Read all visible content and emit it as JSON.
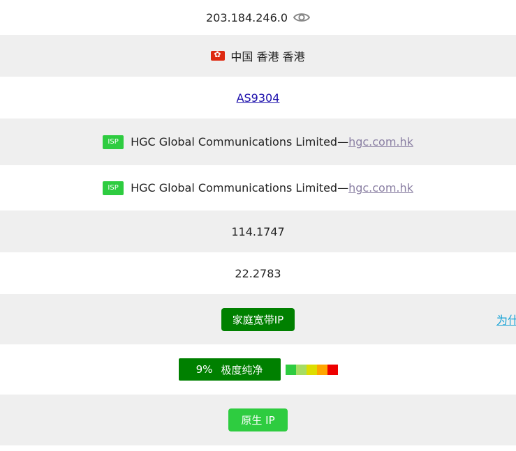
{
  "ip": {
    "address": "203.184.246.0"
  },
  "location": {
    "text": "中国 香港 香港"
  },
  "asn": {
    "label": "AS9304"
  },
  "isp_rows": [
    {
      "badge": "ISP",
      "name": "HGC Global Communications Limited—",
      "domain": "hgc.com.hk"
    },
    {
      "badge": "ISP",
      "name": "HGC Global Communications Limited—",
      "domain": "hgc.com.hk"
    }
  ],
  "coordinates": {
    "longitude": "114.1747",
    "latitude": "22.2783"
  },
  "ip_type": {
    "label": "家庭宽带IP",
    "why_link": "为什"
  },
  "purity": {
    "percent": "9%",
    "label": "极度纯净",
    "scale_colors": [
      "#2ecc40",
      "#a6dd62",
      "#dddd00",
      "#ffa500",
      "#ee0000"
    ]
  },
  "native": {
    "label": "原生 IP"
  },
  "colors": {
    "dark_green": "#008000",
    "light_green": "#2ecc40",
    "row_gray": "#efefef",
    "link_blue": "#1a0dab",
    "domain_purple": "#8a7fa3"
  }
}
